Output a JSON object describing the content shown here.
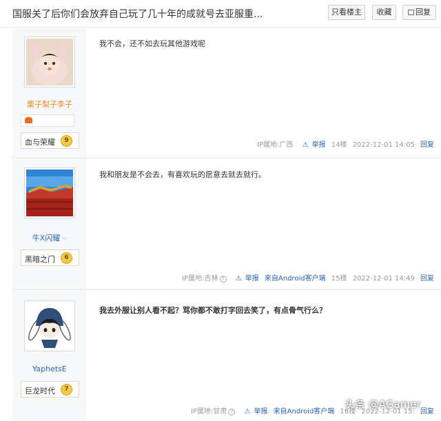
{
  "header": {
    "title": "国服关了后你们会放弃自己玩了几十年的成就号去亚服重...",
    "only_op_label": "只看楼主",
    "favorite_label": "收藏",
    "reply_label": "回复"
  },
  "posts": [
    {
      "username": "栗子梨子李子",
      "badge_name": "血与荣耀",
      "badge_level": "9",
      "content": "我不会，还不如去玩其他游戏呢",
      "ip_label": "IP属地:广西",
      "report_label": "举报",
      "client_label": "",
      "floor": "14楼",
      "time": "2022-12-01 14:05",
      "reply_label": "回复"
    },
    {
      "username": "牛X闪耀",
      "badge_name": "黑暗之门",
      "badge_level": "6",
      "content": "我和朋友是不会去，有喜欢玩的愿意去就去就行。",
      "ip_label": "IP属地:吉林",
      "report_label": "举报",
      "client_label": "来自Android客户端",
      "floor": "15楼",
      "time": "2022-12-01 14:49",
      "reply_label": "回复"
    },
    {
      "username": "YaphetsE",
      "badge_name": "巨龙时代",
      "badge_level": "7",
      "content": "我去外服让别人看不起？骂你都不敢打字回去笑了，有点骨气行么？",
      "ip_label": "IP属地:甘肃",
      "report_label": "举报",
      "client_label": "来自Android客户端",
      "floor": "16楼",
      "time": "2022-12-01 15:",
      "reply_label": "回复"
    }
  ],
  "watermark": "头条 @AGamer",
  "colors": {
    "accent_link": "#2d64b3",
    "username_orange": "#f08a24",
    "sidebar_bg": "#f6f8fa",
    "level_badge": "#f2c94c"
  }
}
